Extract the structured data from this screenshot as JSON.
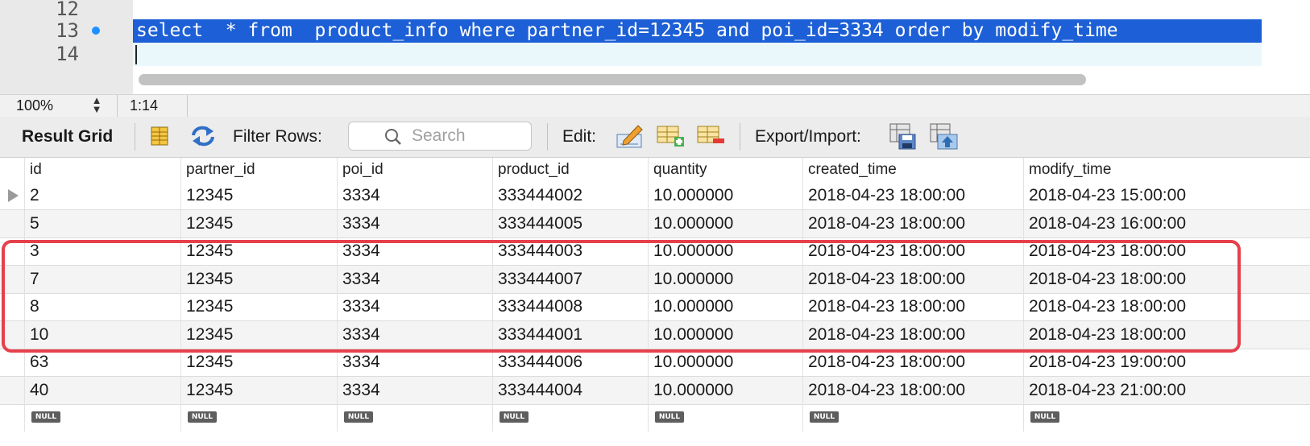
{
  "editor": {
    "lines": [
      {
        "number": "12",
        "text": ""
      },
      {
        "number": "13",
        "text": "select  * from  product_info where partner_id=12345 and poi_id=3334 order by modify_time"
      },
      {
        "number": "14",
        "text": ""
      }
    ]
  },
  "status": {
    "zoom": "100%",
    "cursor": "1:14"
  },
  "toolbar": {
    "result_grid": "Result Grid",
    "filter_rows": "Filter Rows:",
    "search_placeholder": "Search",
    "edit": "Edit:",
    "export_import": "Export/Import:"
  },
  "grid": {
    "columns": [
      "id",
      "partner_id",
      "poi_id",
      "product_id",
      "quantity",
      "created_time",
      "modify_time"
    ],
    "rows": [
      [
        "2",
        "12345",
        "3334",
        "333444002",
        "10.000000",
        "2018-04-23 18:00:00",
        "2018-04-23 15:00:00"
      ],
      [
        "5",
        "12345",
        "3334",
        "333444005",
        "10.000000",
        "2018-04-23 18:00:00",
        "2018-04-23 16:00:00"
      ],
      [
        "3",
        "12345",
        "3334",
        "333444003",
        "10.000000",
        "2018-04-23 18:00:00",
        "2018-04-23 18:00:00"
      ],
      [
        "7",
        "12345",
        "3334",
        "333444007",
        "10.000000",
        "2018-04-23 18:00:00",
        "2018-04-23 18:00:00"
      ],
      [
        "8",
        "12345",
        "3334",
        "333444008",
        "10.000000",
        "2018-04-23 18:00:00",
        "2018-04-23 18:00:00"
      ],
      [
        "10",
        "12345",
        "3334",
        "333444001",
        "10.000000",
        "2018-04-23 18:00:00",
        "2018-04-23 18:00:00"
      ],
      [
        "63",
        "12345",
        "3334",
        "333444006",
        "10.000000",
        "2018-04-23 18:00:00",
        "2018-04-23 19:00:00"
      ],
      [
        "40",
        "12345",
        "3334",
        "333444004",
        "10.000000",
        "2018-04-23 18:00:00",
        "2018-04-23 21:00:00"
      ]
    ],
    "null_label": "NULL"
  },
  "colors": {
    "selection": "#1c5fd6",
    "highlight_box": "#e5414c",
    "breakpoint": "#1e90ff"
  }
}
